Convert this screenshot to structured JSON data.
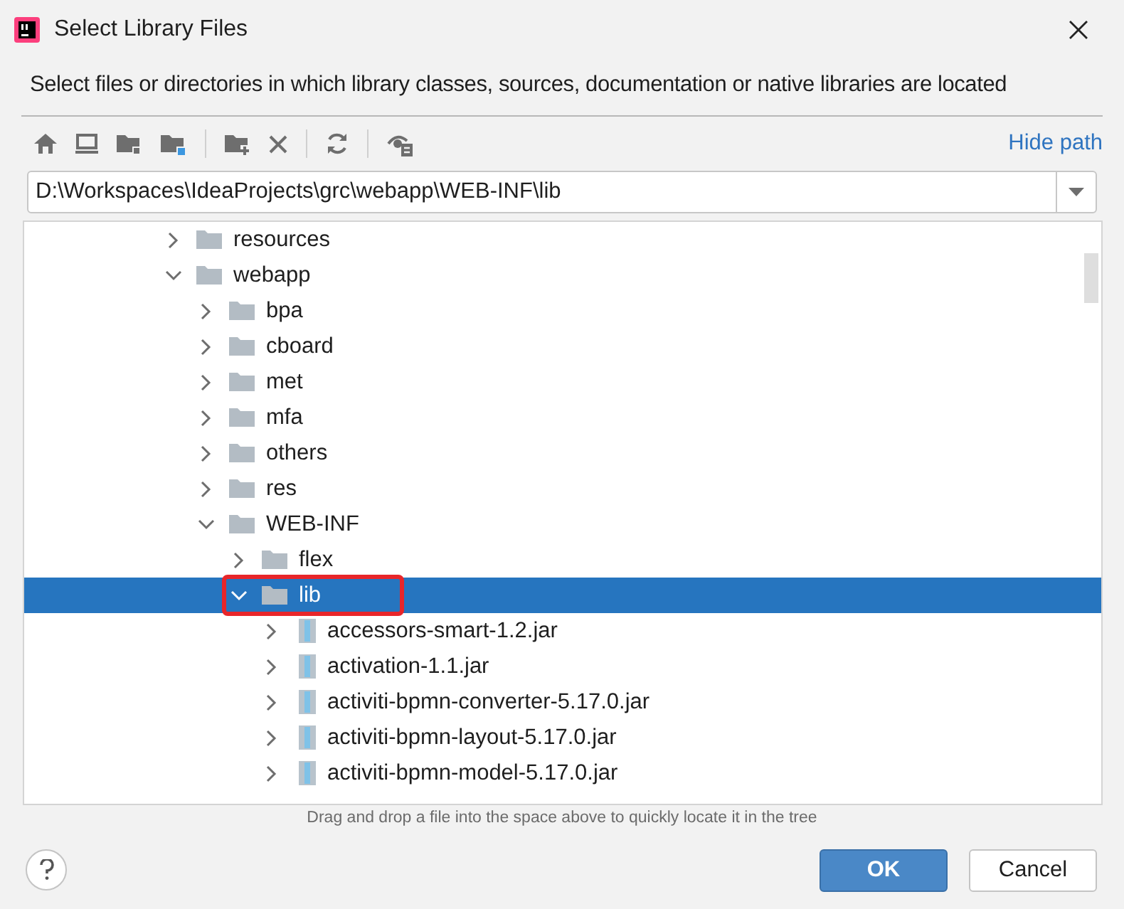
{
  "window": {
    "title": "Select Library Files"
  },
  "description": "Select files or directories in which library classes, sources, documentation or native libraries are located",
  "toolbar": {
    "link": "Hide path"
  },
  "path_field": {
    "value": "D:\\Workspaces\\IdeaProjects\\grc\\webapp\\WEB-INF\\lib"
  },
  "tree": [
    {
      "label": "resources",
      "kind": "folder",
      "expanded": false,
      "selected": false
    },
    {
      "label": "webapp",
      "kind": "folder",
      "expanded": true,
      "selected": false,
      "children": [
        {
          "label": "bpa",
          "kind": "folder",
          "expanded": false,
          "selected": false
        },
        {
          "label": "cboard",
          "kind": "folder",
          "expanded": false,
          "selected": false
        },
        {
          "label": "met",
          "kind": "folder",
          "expanded": false,
          "selected": false
        },
        {
          "label": "mfa",
          "kind": "folder",
          "expanded": false,
          "selected": false
        },
        {
          "label": "others",
          "kind": "folder",
          "expanded": false,
          "selected": false
        },
        {
          "label": "res",
          "kind": "folder",
          "expanded": false,
          "selected": false
        },
        {
          "label": "WEB-INF",
          "kind": "folder",
          "expanded": true,
          "selected": false,
          "children": [
            {
              "label": "flex",
              "kind": "folder",
              "expanded": false,
              "selected": false
            },
            {
              "label": "lib",
              "kind": "folder",
              "expanded": true,
              "selected": true,
              "highlighted": true,
              "children": [
                {
                  "label": "accessors-smart-1.2.jar",
                  "kind": "jar",
                  "expanded": false,
                  "selected": false
                },
                {
                  "label": "activation-1.1.jar",
                  "kind": "jar",
                  "expanded": false,
                  "selected": false
                },
                {
                  "label": "activiti-bpmn-converter-5.17.0.jar",
                  "kind": "jar",
                  "expanded": false,
                  "selected": false
                },
                {
                  "label": "activiti-bpmn-layout-5.17.0.jar",
                  "kind": "jar",
                  "expanded": false,
                  "selected": false
                },
                {
                  "label": "activiti-bpmn-model-5.17.0.jar",
                  "kind": "jar",
                  "expanded": false,
                  "selected": false
                }
              ]
            }
          ]
        }
      ]
    }
  ],
  "hint": "Drag and drop a file into the space above to quickly locate it in the tree",
  "buttons": [
    {
      "label": "OK",
      "kind": "primary"
    },
    {
      "label": "Cancel",
      "kind": "secondary"
    }
  ]
}
